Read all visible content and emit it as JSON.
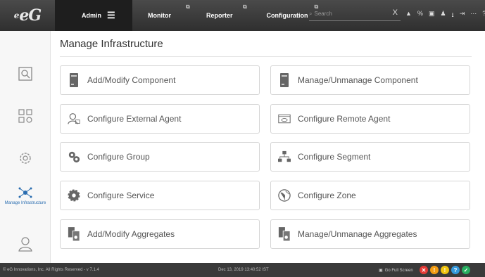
{
  "app": {
    "logo_text": "eG"
  },
  "nav": {
    "admin_label": "Admin",
    "hamburger": "☰",
    "monitor_label": "Monitor",
    "reporter_label": "Reporter",
    "configuration_label": "Configuration"
  },
  "search": {
    "placeholder": "Search",
    "clear": "X"
  },
  "sidebar": {
    "items": [
      {
        "label": "",
        "icon": "search-icon"
      },
      {
        "label": "",
        "icon": "grid-icon"
      },
      {
        "label": "",
        "icon": "gear-icon"
      },
      {
        "label": "Manage Infrastructure",
        "icon": "network-icon"
      },
      {
        "label": "",
        "icon": "user-icon"
      }
    ]
  },
  "main": {
    "title": "Manage Infrastructure",
    "cards": [
      {
        "label": "Add/Modify Component",
        "icon": "server-icon"
      },
      {
        "label": "Manage/Unmanage Component",
        "icon": "server-icon"
      },
      {
        "label": "Configure External Agent",
        "icon": "agent-icon"
      },
      {
        "label": "Configure Remote Agent",
        "icon": "remote-agent-icon"
      },
      {
        "label": "Configure Group",
        "icon": "group-gear-icon"
      },
      {
        "label": "Configure Segment",
        "icon": "segment-icon"
      },
      {
        "label": "Configure Service",
        "icon": "service-gear-icon"
      },
      {
        "label": "Configure Zone",
        "icon": "zone-icon"
      },
      {
        "label": "Add/Modify Aggregates",
        "icon": "aggregates-icon"
      },
      {
        "label": "Manage/Unmanage Aggregates",
        "icon": "aggregates-icon"
      }
    ]
  },
  "footer": {
    "copyright": "© eG Innovations, Inc. All Rights Reserved - v 7.1.4",
    "datetime": "Dec 13, 2019 13:40:52 IST",
    "fullscreen": "Go Full Screen"
  },
  "colors": {
    "topbar": "#333333",
    "accent_blue": "#2a6db0",
    "dot_red": "#e53935",
    "dot_orange": "#f39c12",
    "dot_yellow": "#f1c40f",
    "dot_blue": "#3498db",
    "dot_green": "#27ae60"
  }
}
